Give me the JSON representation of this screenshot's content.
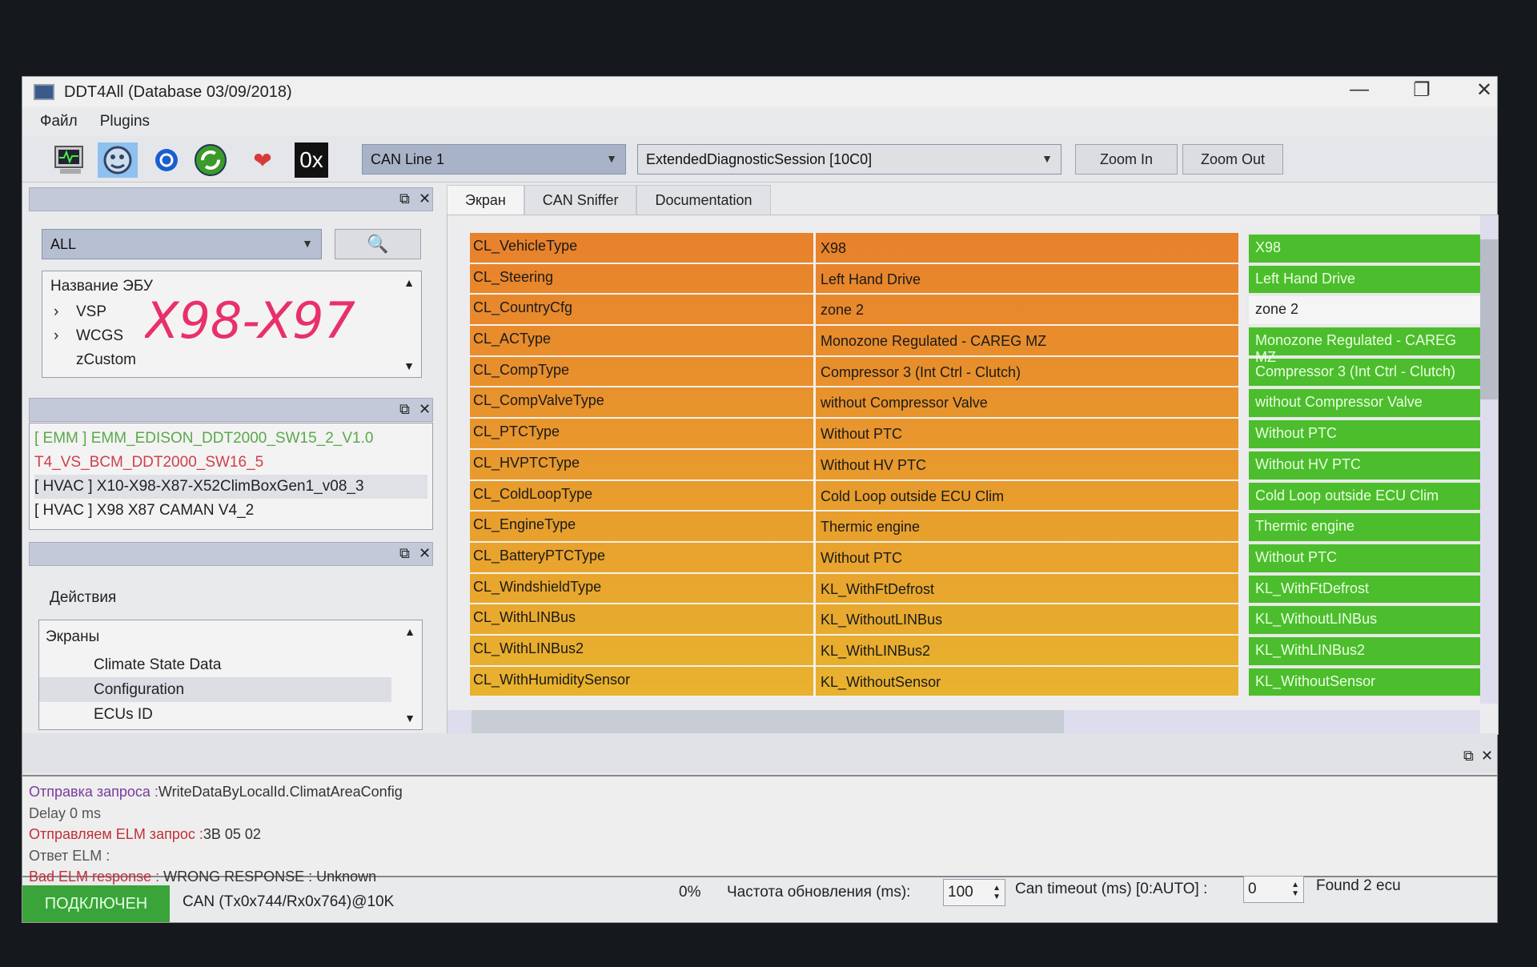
{
  "window": {
    "title": "DDT4All (Database 03/09/2018)",
    "minimize": "—",
    "maximize": "❐",
    "close": "✕"
  },
  "menu": [
    "Файл",
    "Plugins"
  ],
  "toolbar": {
    "icons": [
      "monitor-icon",
      "ecu-scan-icon",
      "refresh-blue-icon",
      "refresh-green-icon",
      "heart-plus-icon",
      "hex-icon"
    ],
    "hex_label": "0x",
    "can_line": "CAN Line 1",
    "session": "ExtendedDiagnosticSession [10C0]",
    "zoom_in": "Zoom In",
    "zoom_out": "Zoom Out"
  },
  "left": {
    "filter": "ALL",
    "tree_header": "Название ЭБУ",
    "tree": [
      {
        "label": "VSP",
        "expandable": true
      },
      {
        "label": "WCGS",
        "expandable": true
      },
      {
        "label": "zCustom",
        "expandable": false
      }
    ],
    "ecus": [
      {
        "label": "[ EMM ] EMM_EDISON_DDT2000_SW15_2_V1.0",
        "color": "#5aa84a"
      },
      {
        "label": "T4_VS_BCM_DDT2000_SW16_5",
        "color": "#d0404a"
      },
      {
        "label": "[ HVAC ] X10-X98-X87-X52ClimBoxGen1_v08_3",
        "color": "#222222"
      },
      {
        "label": "[ HVAC ] X98 X87 CAMAN V4_2",
        "color": "#222222"
      }
    ],
    "actions_label": "Действия",
    "screens_header": "Экраны",
    "screens": [
      "Climate State Data",
      "Configuration",
      "ECUs ID"
    ],
    "handwriting": "X98-X97"
  },
  "tabs": [
    "Экран",
    "CAN Sniffer",
    "Documentation"
  ],
  "rows": [
    {
      "name": "CL_VehicleType",
      "value": "X98",
      "current": "X98"
    },
    {
      "name": "CL_Steering",
      "value": "Left Hand Drive",
      "current": "Left Hand Drive"
    },
    {
      "name": "CL_CountryCfg",
      "value": "zone 2",
      "current": "zone 2"
    },
    {
      "name": "CL_ACType",
      "value": "Monozone Regulated -  CAREG MZ",
      "current": "Monozone Regulated -  CAREG MZ"
    },
    {
      "name": "CL_CompType",
      "value": "Compressor 3 (Int Ctrl - Clutch)",
      "current": "Compressor 3 (Int Ctrl - Clutch)"
    },
    {
      "name": "CL_CompValveType",
      "value": "without Compressor Valve",
      "current": "without Compressor Valve"
    },
    {
      "name": "CL_PTCType",
      "value": "Without PTC",
      "current": "Without PTC"
    },
    {
      "name": "CL_HVPTCType",
      "value": "Without HV PTC",
      "current": "Without HV PTC"
    },
    {
      "name": "CL_ColdLoopType",
      "value": "Cold Loop outside ECU Clim",
      "current": "Cold Loop outside ECU Clim"
    },
    {
      "name": "CL_EngineType",
      "value": "Thermic engine",
      "current": "Thermic engine"
    },
    {
      "name": "CL_BatteryPTCType",
      "value": "Without PTC",
      "current": "Without PTC"
    },
    {
      "name": "CL_WindshieldType",
      "value": "KL_WithFtDefrost",
      "current": "KL_WithFtDefrost"
    },
    {
      "name": "CL_WithLINBus",
      "value": "KL_WithoutLINBus",
      "current": "KL_WithoutLINBus"
    },
    {
      "name": "CL_WithLINBus2",
      "value": "KL_WithLINBus2",
      "current": "KL_WithLINBus2"
    },
    {
      "name": "CL_WithHumiditySensor",
      "value": "KL_WithoutSensor",
      "current": "KL_WithoutSensor"
    }
  ],
  "log": [
    {
      "label": "Отправка запроса :",
      "text": "WriteDataByLocalId.ClimatAreaConfig",
      "color": "#7a3aa0"
    },
    {
      "label": "",
      "text": "Delay 0 ms",
      "color": "#555555"
    },
    {
      "label": "Отправляем ELM запрос :",
      "text": "3B 05 02",
      "color": "#c0303a"
    },
    {
      "label": "",
      "text": "Ответ ELM :",
      "color": "#555555"
    },
    {
      "label": "Bad ELM response :",
      "text": " WRONG RESPONSE : Unknown",
      "color": "#c0303a"
    }
  ],
  "status": {
    "connected": "ПОДКЛЮЧЕН",
    "can_info": "CAN (Tx0x744/Rx0x764)@10K",
    "progress": "0%",
    "refresh_label": "Частота обновления (ms):",
    "refresh_value": "100",
    "timeout_label": "Can timeout (ms) [0:AUTO] :",
    "timeout_value": "0",
    "found": "Found 2 ecu"
  },
  "colors": {
    "accent_green": "#4cbd2c",
    "row_orange": "#e8812c",
    "row_yellow": "#e8b22e",
    "handwriting": "#e8306a"
  }
}
